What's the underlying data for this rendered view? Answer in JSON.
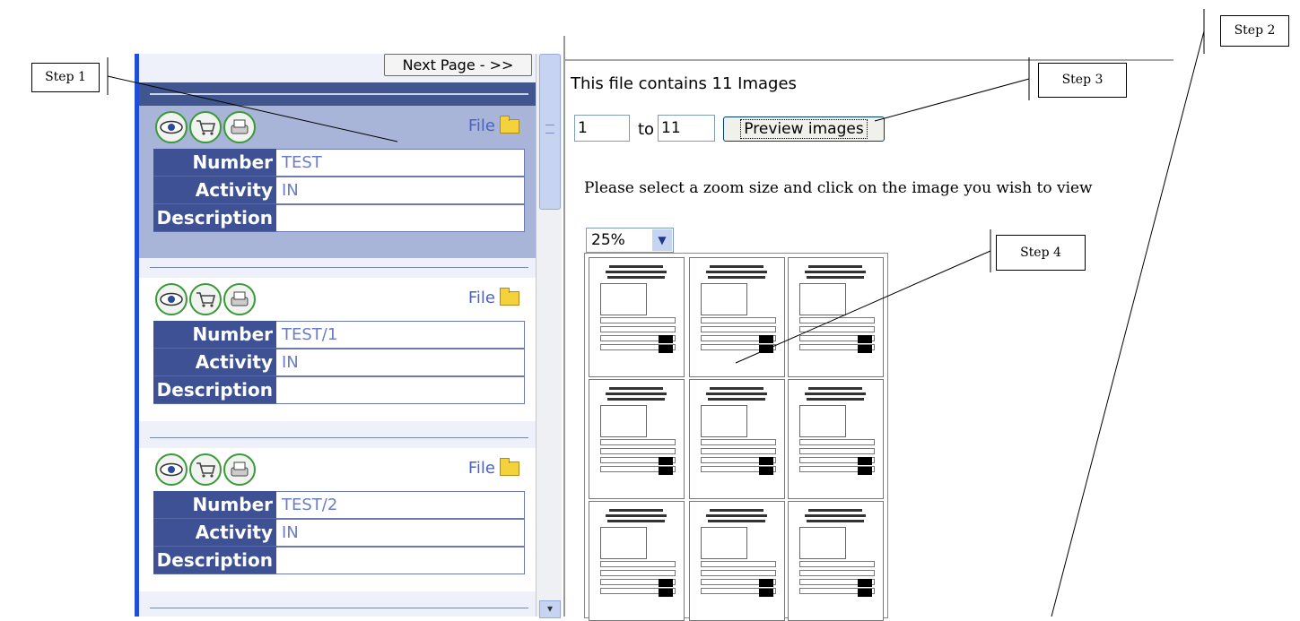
{
  "left": {
    "next_page": "Next Page - >>",
    "records": [
      {
        "file": "File",
        "fields": [
          {
            "label": "Number",
            "value": "TEST"
          },
          {
            "label": "Activity",
            "value": "IN"
          },
          {
            "label": "Description",
            "value": ""
          }
        ]
      },
      {
        "file": "File",
        "fields": [
          {
            "label": "Number",
            "value": "TEST/1"
          },
          {
            "label": "Activity",
            "value": "IN"
          },
          {
            "label": "Description",
            "value": ""
          }
        ]
      },
      {
        "file": "File",
        "fields": [
          {
            "label": "Number",
            "value": "TEST/2"
          },
          {
            "label": "Activity",
            "value": "IN"
          },
          {
            "label": "Description",
            "value": ""
          }
        ]
      }
    ]
  },
  "right": {
    "contains": "This file contains 11 Images",
    "from_value": "1",
    "to_label": "to",
    "to_value": "11",
    "preview_button": "Preview images",
    "instruction": "Please select a zoom size and click on the image you wish to view",
    "zoom": "25%"
  },
  "steps": {
    "step1": "Step 1",
    "step2": "Step 2",
    "step3": "Step 3",
    "step4": "Step 4"
  },
  "icons": [
    "eye-icon",
    "cart-icon",
    "printer-icon",
    "folder-icon",
    "chevron-down-icon"
  ]
}
